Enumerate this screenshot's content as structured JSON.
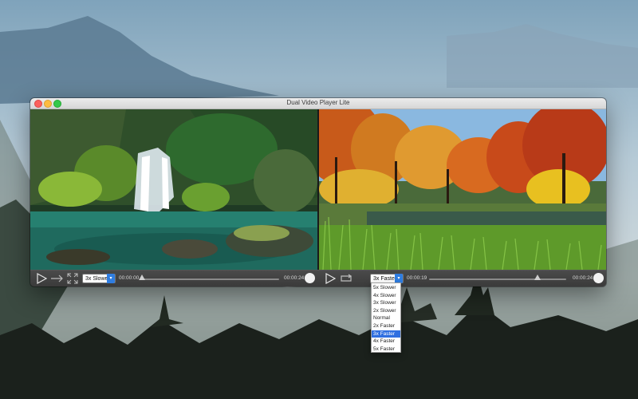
{
  "window": {
    "title": "Dual Video Player Lite"
  },
  "left_player": {
    "speed": "3x Slower",
    "elapsed": "00:00:00",
    "duration": "00:00:24",
    "progress": 0.0
  },
  "right_player": {
    "speed": "3x Faster",
    "elapsed": "00:00:19",
    "duration": "00:00:24",
    "progress": 0.79
  },
  "speed_menu": {
    "options": [
      "5x Slower",
      "4x Slower",
      "3x Slower",
      "2x Slower",
      "Normal",
      "2x Faster",
      "3x Faster",
      "4x Faster",
      "5x Faster"
    ],
    "selected": "3x Faster"
  },
  "colors": {
    "accent": "#2f6fe0",
    "close": "#fc605c",
    "minimize": "#fdbc40",
    "maximize": "#34c84a"
  }
}
